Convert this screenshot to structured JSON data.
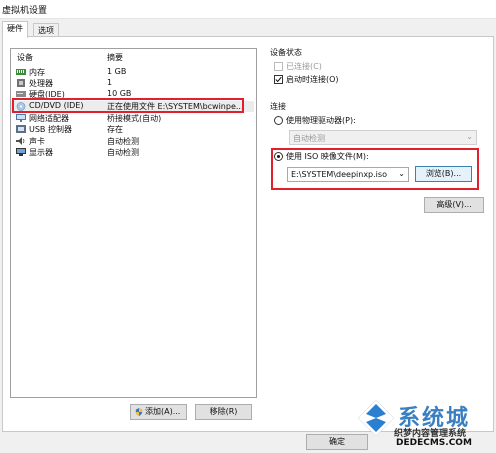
{
  "window": {
    "title": "虚拟机设置"
  },
  "tabs": [
    {
      "label": "硬件"
    },
    {
      "label": "选项"
    }
  ],
  "devices": {
    "header": {
      "device": "设备",
      "summary": "摘要"
    },
    "rows": [
      {
        "name": "内存",
        "summary": "1 GB",
        "icon": "memory-icon"
      },
      {
        "name": "处理器",
        "summary": "1",
        "icon": "cpu-icon"
      },
      {
        "name": "硬盘(IDE)",
        "summary": "10 GB",
        "icon": "harddisk-icon"
      },
      {
        "name": "CD/DVD (IDE)",
        "summary": "正在使用文件 E:\\SYSTEM\\bcwinpe...",
        "icon": "cd-icon"
      },
      {
        "name": "网络适配器",
        "summary": "桥接模式(自动)",
        "icon": "network-icon"
      },
      {
        "name": "USB 控制器",
        "summary": "存在",
        "icon": "usb-icon"
      },
      {
        "name": "声卡",
        "summary": "自动检测",
        "icon": "sound-icon"
      },
      {
        "name": "显示器",
        "summary": "自动检测",
        "icon": "display-icon"
      }
    ],
    "add_label": "添加(A)...",
    "remove_label": "移除(R)"
  },
  "device_status": {
    "title": "设备状态",
    "connected_label": "已连接(C)",
    "connect_on_power_label": "启动时连接(O)"
  },
  "connection": {
    "title": "连接",
    "physical_label": "使用物理驱动器(P):",
    "physical_value": "自动检测",
    "iso_label": "使用 ISO 映像文件(M):",
    "iso_value": "E:\\SYSTEM\\deepinxp.iso",
    "browse_label": "浏览(B)...",
    "advanced_label": "高级(V)..."
  },
  "footer": {
    "ok_label": "确定"
  },
  "watermark": {
    "brand": "系统城",
    "line1": "织梦内容管理系统",
    "site": "DEDECMS.COM"
  },
  "colors": {
    "highlight": "#e0202c",
    "accent": "#3a7fc1"
  }
}
